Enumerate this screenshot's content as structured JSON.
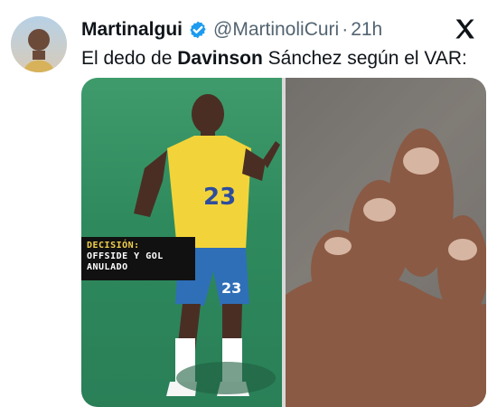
{
  "tweet": {
    "author": {
      "display_name": "Martinalgui",
      "handle": "@MartinoliCuri",
      "time_ago": "21h",
      "verified_color": "#1d9bf0"
    },
    "text_parts": {
      "prefix": "El dedo de",
      "bold_name": "Davinson",
      "suffix": "Sánchez según el VAR:"
    },
    "media": {
      "overlay": {
        "title": "DECISIÓN:",
        "lines": [
          "OFFSIDE Y GOL",
          "ANULADO"
        ]
      },
      "jersey_number": "23",
      "shorts_number": "23"
    }
  }
}
